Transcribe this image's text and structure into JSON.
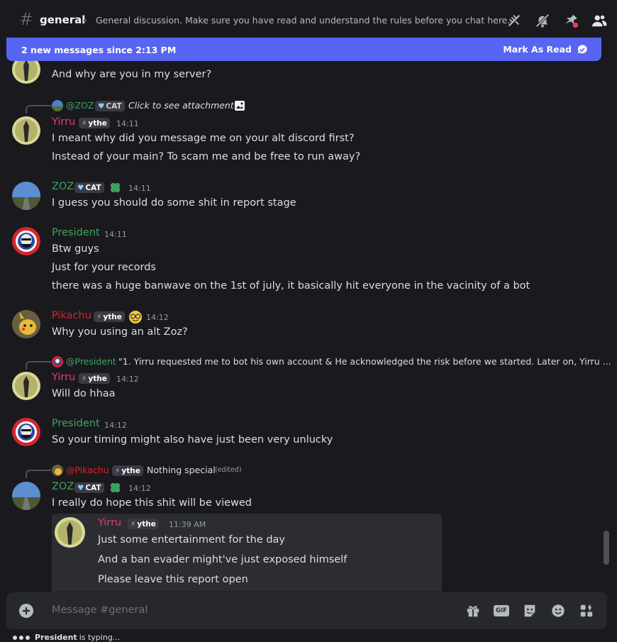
{
  "header": {
    "channel_name": "general",
    "topic": "General discussion. Make sure you have read and understand the rules before you chat here.",
    "icons": [
      "threads-icon",
      "mute-bell-icon",
      "pin-icon",
      "member-list-icon"
    ]
  },
  "banner": {
    "text": "2 new messages since 2:13 PM",
    "mark_read_label": "Mark As Read"
  },
  "messages": [
    {
      "id": "m0",
      "text": "And why are you in my server?"
    },
    {
      "id": "m1",
      "reply": {
        "name": "@ZOZ",
        "tag": "CAT",
        "text": "Click to see attachment"
      },
      "author": "Yirru",
      "tag": "ythe",
      "time": "14:11",
      "lines": [
        "I meant why did you message me on your alt discord first?",
        "Instead of your main? To scam me and be free to run away?"
      ]
    },
    {
      "id": "m2",
      "author": "ZOZ",
      "tag": "CAT",
      "time": "14:11",
      "lines": [
        "I guess you should do some shit in report stage"
      ]
    },
    {
      "id": "m3",
      "author": "President",
      "time": "14:11",
      "lines": [
        "Btw guys",
        "Just for your records",
        "there was a huge banwave on the 1st of july, it basically hit everyone in the vacinity of a bot"
      ]
    },
    {
      "id": "m4",
      "author": "Pikachu",
      "tag": "ythe",
      "time": "14:12",
      "lines": [
        "Why you using an alt Zoz?"
      ]
    },
    {
      "id": "m5",
      "reply": {
        "name": "@President",
        "text": "\"1. Yirru requested me to bot his own account & He acknowledged the risk before we started. Later on, Yirru ..."
      },
      "author": "Yirru",
      "tag": "ythe",
      "time": "14:12",
      "lines": [
        "Will do hhaa"
      ]
    },
    {
      "id": "m6",
      "author": "President",
      "time": "14:12",
      "lines": [
        "So your timing might also have just been very unlucky"
      ]
    },
    {
      "id": "m7",
      "reply": {
        "name": "@Pikachu",
        "tag": "ythe",
        "text": "Nothing special",
        "edited": "(edited)"
      },
      "author": "ZOZ",
      "tag": "CAT",
      "time": "14:12",
      "lines": [
        "I really do hope this shit will be viewed"
      ],
      "embed": {
        "author": "Yirru",
        "tag": "ythe",
        "time": "11:39 AM",
        "lines": [
          "Just some entertainment for the day",
          "And a ban evader might've just exposed himself",
          "Please leave this report open"
        ]
      }
    }
  ],
  "composer": {
    "placeholder": "Message #general",
    "icons": [
      "add-icon",
      "gift-icon",
      "gif-icon",
      "sticker-icon",
      "emoji-icon",
      "apps-icon"
    ],
    "gif_label": "GIF"
  },
  "typing": {
    "user": "President",
    "text": "is typing..."
  },
  "colors": {
    "yirru": "#e33b7a",
    "green": "#3ba55d",
    "pikachu": "#e91d1d",
    "banner": "#5865f2"
  }
}
